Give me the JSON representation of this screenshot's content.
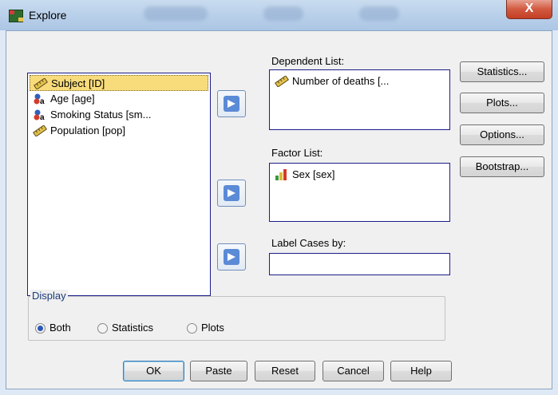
{
  "window": {
    "title": "Explore",
    "close_glyph": "X"
  },
  "variables": {
    "items": [
      {
        "label": "Subject [ID]",
        "icon": "ruler-icon",
        "selected": true
      },
      {
        "label": "Age [age]",
        "icon": "nominal-icon",
        "selected": false
      },
      {
        "label": "Smoking Status [sm...",
        "icon": "nominal-icon",
        "selected": false
      },
      {
        "label": "Population [pop]",
        "icon": "ruler-icon",
        "selected": false
      }
    ]
  },
  "dependent_list": {
    "label": "Dependent List:",
    "items": [
      {
        "label": "Number of deaths [...",
        "icon": "ruler-icon"
      }
    ]
  },
  "factor_list": {
    "label": "Factor List:",
    "items": [
      {
        "label": "Sex [sex]",
        "icon": "bar-chart-icon"
      }
    ]
  },
  "label_cases": {
    "label": "Label Cases by:",
    "value": ""
  },
  "side_buttons": {
    "statistics": "Statistics...",
    "plots": "Plots...",
    "options": "Options...",
    "bootstrap": "Bootstrap..."
  },
  "display": {
    "title": "Display",
    "options": [
      {
        "label": "Both",
        "checked": true
      },
      {
        "label": "Statistics",
        "checked": false
      },
      {
        "label": "Plots",
        "checked": false
      }
    ]
  },
  "bottom_buttons": {
    "ok": "OK",
    "paste": "Paste",
    "reset": "Reset",
    "cancel": "Cancel",
    "help": "Help"
  },
  "colors": {
    "selection": "#f8dc7c",
    "arrow": "#5b8ad6",
    "listbox_border": "#1c1c8a"
  }
}
